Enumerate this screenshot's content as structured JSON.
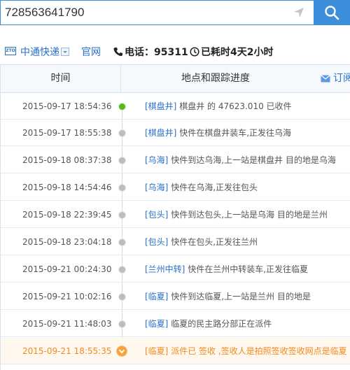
{
  "search": {
    "value": "728563641790",
    "locate_icon": "location-arrow-icon",
    "button_icon": "search-icon"
  },
  "company": {
    "logo": "ZTO",
    "name": "中通快递",
    "website_label": "官网",
    "phone_label": "电话：95311",
    "elapsed_label": "已耗时4天2小时"
  },
  "table": {
    "col_time": "时间",
    "col_progress": "地点和跟踪进度",
    "subscribe_label": "订阅"
  },
  "events": [
    {
      "time": "2015-09-17 18:54:36",
      "city": "[棋盘井]",
      "text": " 棋盘井 的 47623.010 已收件"
    },
    {
      "time": "2015-09-17 18:55:38",
      "city": "[棋盘井]",
      "text": " 快件在棋盘井装车,正发往乌海"
    },
    {
      "time": "2015-09-18 08:37:38",
      "city": "[乌海]",
      "text": " 快件到达乌海,上一站是棋盘井 目的地是乌海"
    },
    {
      "time": "2015-09-18 14:54:46",
      "city": "[乌海]",
      "text": " 快件在乌海,正发往包头"
    },
    {
      "time": "2015-09-18 22:39:45",
      "city": "[包头]",
      "text": " 快件到达包头,上一站是乌海 目的地是兰州"
    },
    {
      "time": "2015-09-18 23:04:18",
      "city": "[包头]",
      "text": " 快件在包头,正发往兰州"
    },
    {
      "time": "2015-09-21 00:24:30",
      "city": "[兰州中转]",
      "text": " 快件在兰州中转装车,正发往临夏"
    },
    {
      "time": "2015-09-21 10:02:16",
      "city": "[临夏]",
      "text": " 快件到达临夏,上一站是兰州 目的地是"
    },
    {
      "time": "2015-09-21 11:48:03",
      "city": "[临夏]",
      "text": " 临夏的民主路分部正在派件"
    },
    {
      "time": "2015-09-21 18:55:35",
      "city": "[临夏]",
      "text": " 派件已 签收 ,签收人是拍照签收签收网点是临夏"
    }
  ],
  "colors": {
    "accent": "#3d8fdc",
    "link": "#2a6fc9",
    "first_dot": "#57b81f",
    "latest": "#f08a1e"
  }
}
